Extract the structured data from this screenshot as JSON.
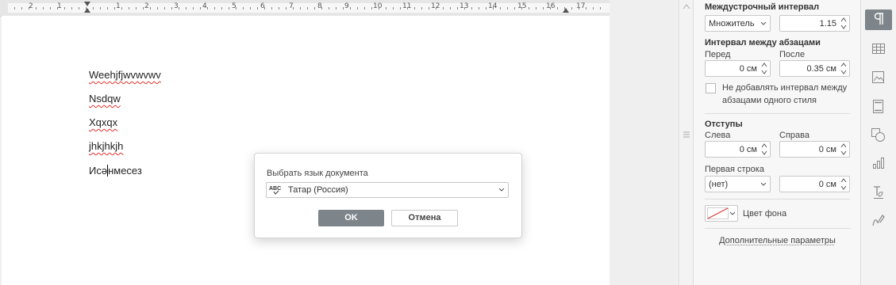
{
  "ruler": {
    "labels": [
      "2",
      "1",
      "1",
      "2",
      "3",
      "4",
      "5",
      "6",
      "7",
      "8",
      "9",
      "10",
      "11",
      "12",
      "13",
      "14",
      "15",
      "16",
      "17"
    ]
  },
  "document": {
    "lines": [
      "Weehjfjwvwvwv",
      "Nsdqw",
      "Xqxqx",
      "jhkjhkjh"
    ],
    "last_line_before_cursor": "Исә",
    "last_line_after_cursor": "нмесез"
  },
  "dialog": {
    "label": "Выбрать язык документа",
    "language_icon": "language-abc-check-icon",
    "language_value": "Татар (Россия)",
    "ok_label": "OK",
    "cancel_label": "Отмена"
  },
  "panel": {
    "line_spacing_title": "Междустрочный интервал",
    "line_spacing_type": "Множитель",
    "line_spacing_value": "1.15",
    "paragraph_spacing_title": "Интервал между абзацами",
    "before_label": "Перед",
    "after_label": "После",
    "before_value": "0 см",
    "after_value": "0.35 см",
    "no_spacing_line1": "Не добавлять интервал между",
    "no_spacing_line2": "абзацами одного стиля",
    "no_spacing_checked": false,
    "indents_title": "Отступы",
    "left_label": "Слева",
    "right_label": "Справа",
    "left_value": "0 см",
    "right_value": "0 см",
    "first_line_label": "Первая строка",
    "first_line_type": "(нет)",
    "first_line_value": "0 см",
    "background_color_label": "Цвет фона",
    "advanced_link": "Дополнительные параметры"
  },
  "right_toolbar": {
    "items": [
      "paragraph-icon",
      "table-icon",
      "image-icon",
      "header-footer-icon",
      "shape-icon",
      "chart-icon",
      "text-art-icon",
      "signature-icon"
    ],
    "active": "paragraph-icon"
  },
  "colors": {
    "accent": "#7d858a",
    "spellcheck": "#e03030",
    "no_fill_line": "#e03030"
  }
}
